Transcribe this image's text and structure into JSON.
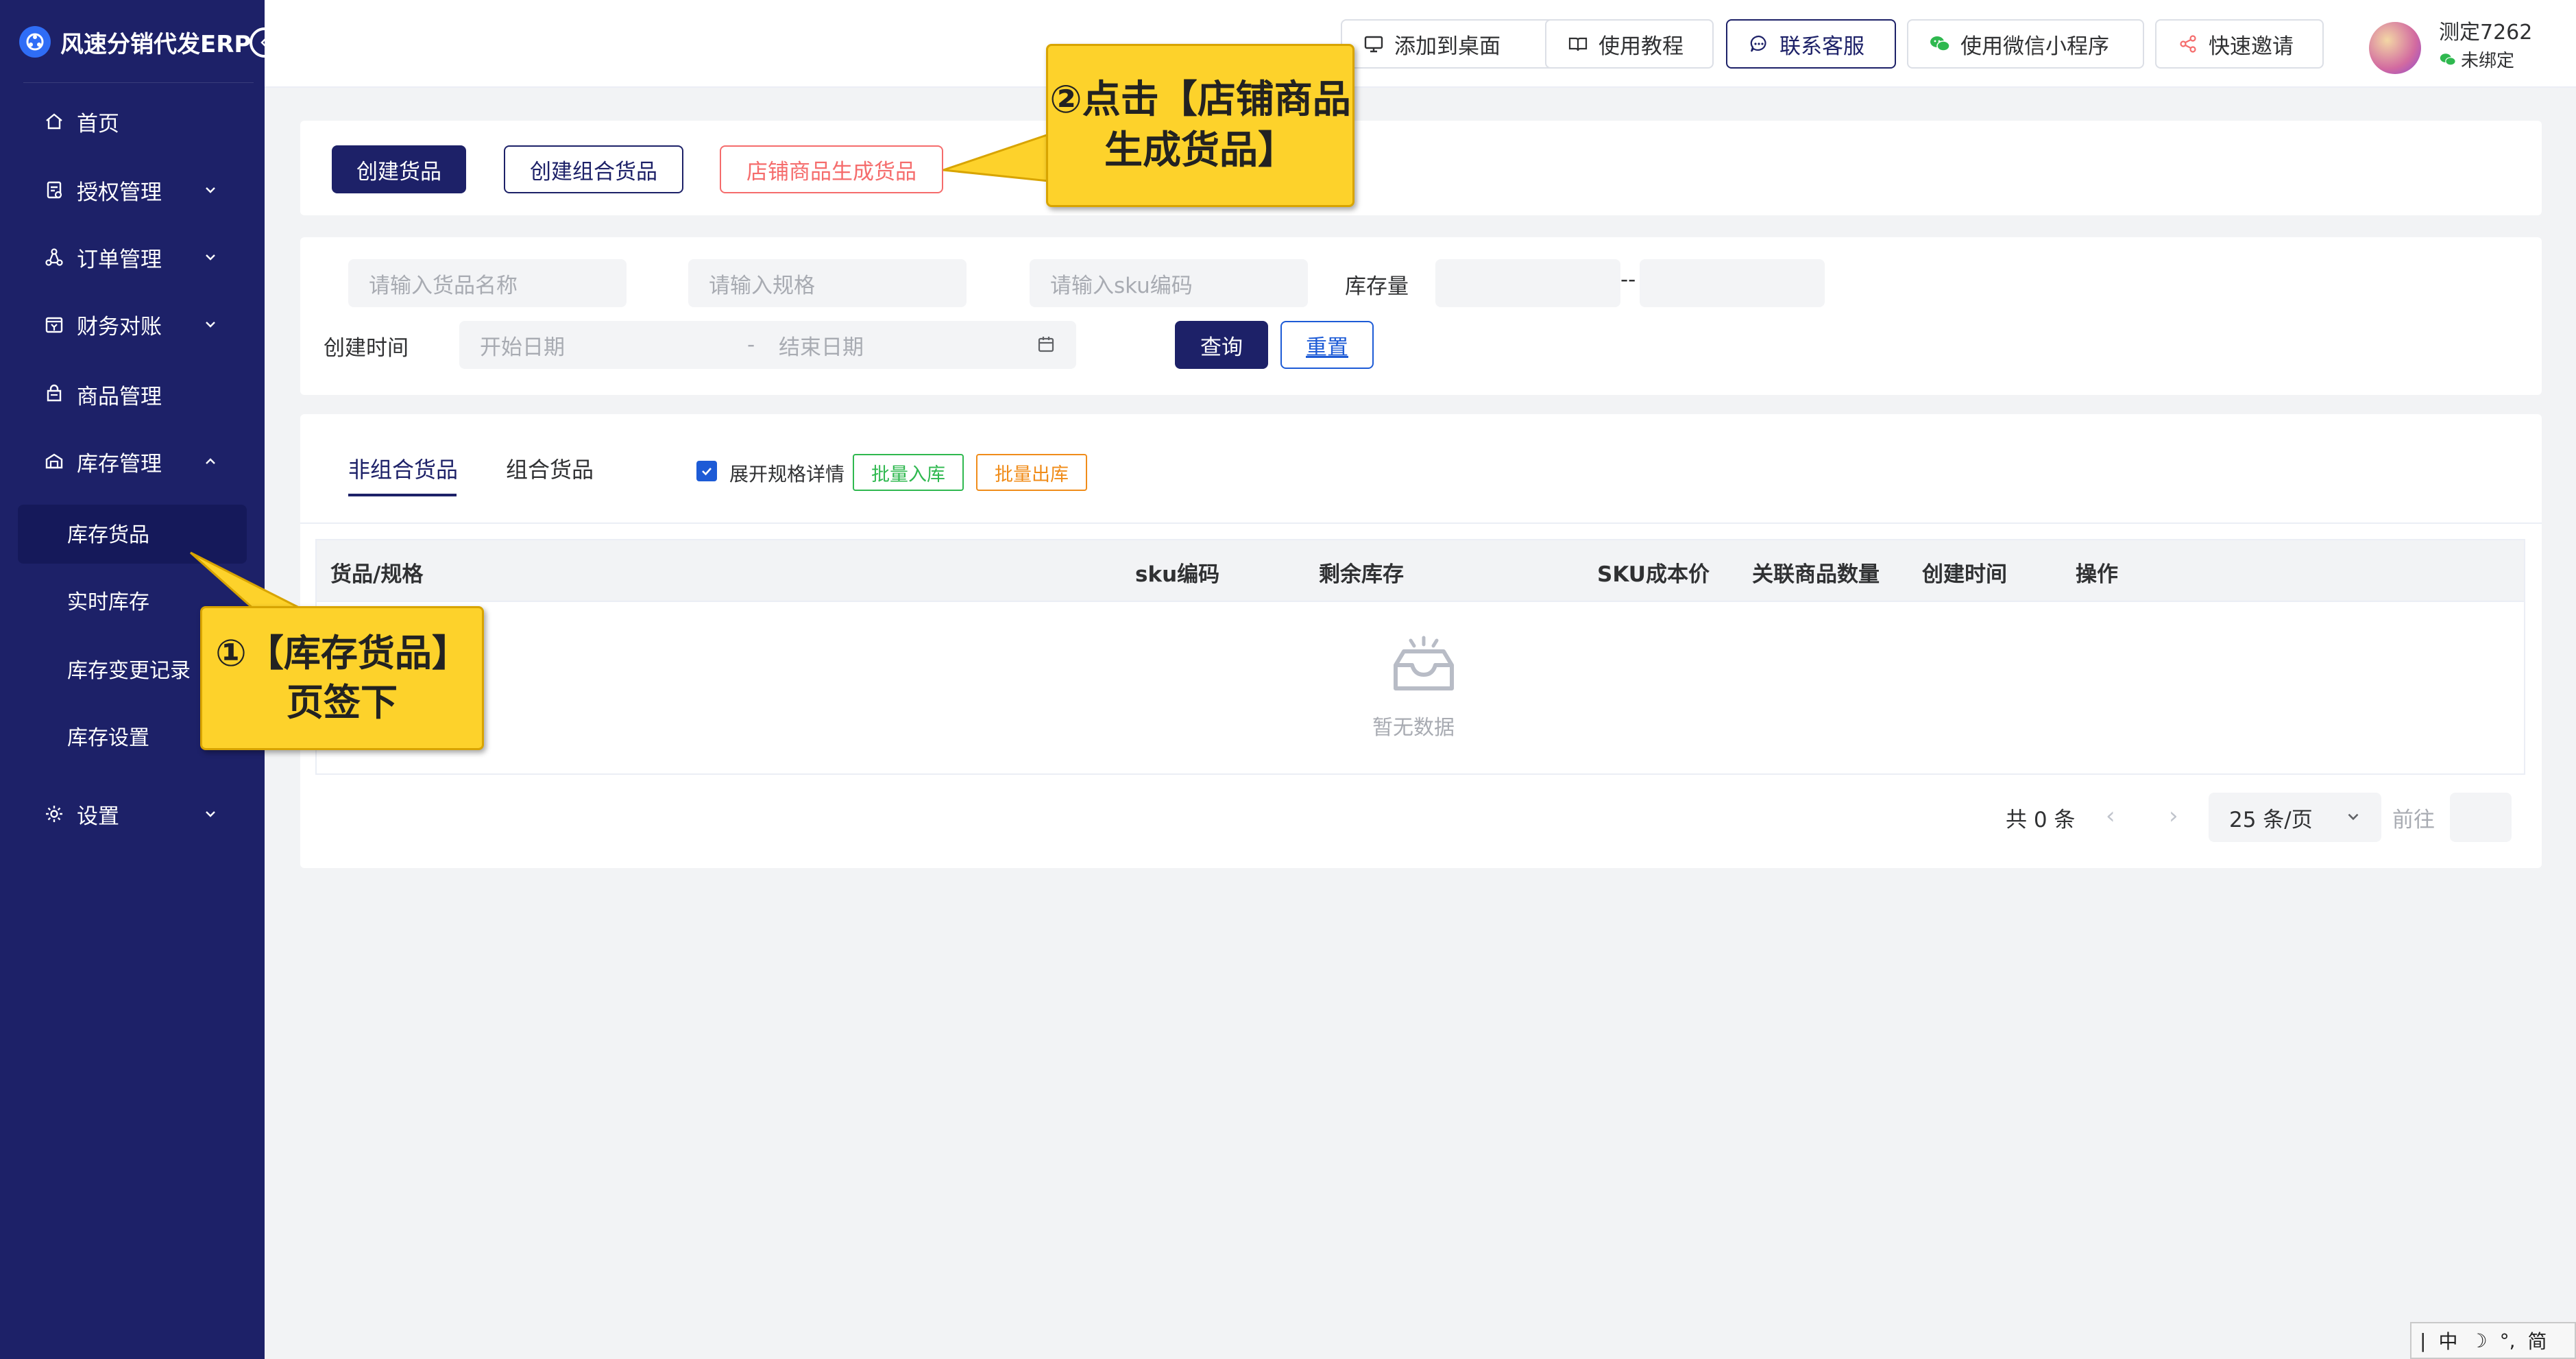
{
  "app": {
    "title": "风速分销代发ERP"
  },
  "sidebar": {
    "items": [
      {
        "label": "首页",
        "icon": "home-icon"
      },
      {
        "label": "授权管理",
        "icon": "license-icon"
      },
      {
        "label": "订单管理",
        "icon": "order-icon"
      },
      {
        "label": "财务对账",
        "icon": "finance-icon"
      },
      {
        "label": "商品管理",
        "icon": "goods-icon"
      },
      {
        "label": "库存管理",
        "icon": "inventory-icon"
      },
      {
        "label": "设置",
        "icon": "gear-icon"
      }
    ],
    "inventory_sub": [
      {
        "label": "库存货品"
      },
      {
        "label": "实时库存"
      },
      {
        "label": "库存变更记录"
      },
      {
        "label": "库存设置"
      }
    ]
  },
  "topbar": {
    "add_desktop": "添加到桌面",
    "tutorial": "使用教程",
    "contact": "联系客服",
    "wechat_app": "使用微信小程序",
    "invite": "快速邀请",
    "user_name": "测定7262",
    "user_bind": "未绑定"
  },
  "actions": {
    "create_goods": "创建货品",
    "create_combo": "创建组合货品",
    "shop_generate": "店铺商品生成货品"
  },
  "filters": {
    "goods_name_placeholder": "请输入货品名称",
    "spec_placeholder": "请输入规格",
    "sku_placeholder": "请输入sku编码",
    "stock_label": "库存量",
    "stock_sep": "--",
    "created_label": "创建时间",
    "start_date": "开始日期",
    "date_sep": "-",
    "end_date": "结束日期",
    "query": "查询",
    "reset": "重置"
  },
  "tabs": {
    "non_combo": "非组合货品",
    "combo": "组合货品",
    "expand_spec": "展开规格详情",
    "batch_in": "批量入库",
    "batch_out": "批量出库"
  },
  "table": {
    "columns": [
      "货品/规格",
      "sku编码",
      "剩余库存",
      "SKU成本价",
      "关联商品数量",
      "创建时间",
      "操作"
    ],
    "empty_text": "暂无数据"
  },
  "pager": {
    "total": "共 0 条",
    "page_size": "25 条/页",
    "goto": "前往"
  },
  "callouts": {
    "step2": "②点击【店铺商品生成货品】",
    "step1": "①【库存货品】页签下"
  },
  "ime": {
    "chars": [
      "中",
      "简"
    ]
  },
  "colors": {
    "sidebar": "#1d2168",
    "accent": "#1d2168",
    "danger": "#f56c6c",
    "success": "#2fb84f",
    "warning": "#f08c1a",
    "callout": "#fdd22b"
  }
}
